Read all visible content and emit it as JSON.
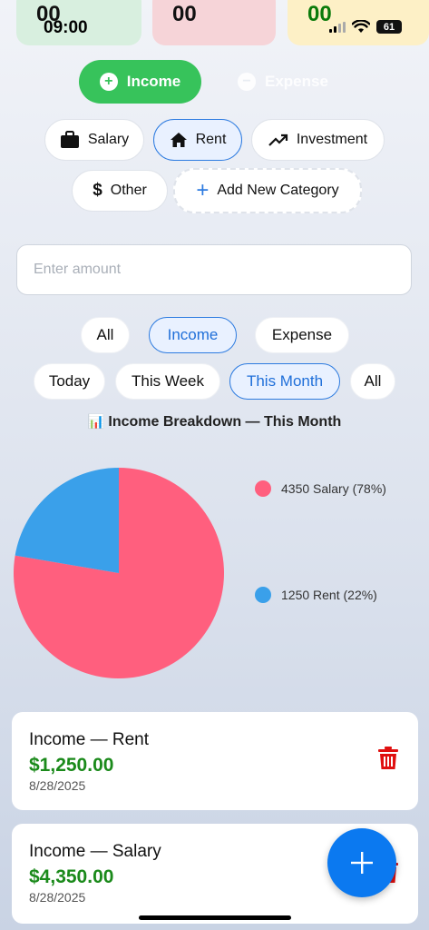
{
  "status_bar": {
    "time": "09:00",
    "battery": "61"
  },
  "summary": {
    "income_value": "00",
    "expense_value": "00",
    "balance_value": "00"
  },
  "type_toggle": {
    "income_label": "Income",
    "expense_label": "Expense",
    "selected": "Income"
  },
  "categories": [
    {
      "label": "Salary",
      "icon": "briefcase-icon"
    },
    {
      "label": "Rent",
      "icon": "home-icon",
      "selected": true
    },
    {
      "label": "Investment",
      "icon": "trending-up-icon"
    },
    {
      "label": "Other",
      "icon": "dollar-icon"
    },
    {
      "label": "Add New Category",
      "icon": "plus-icon"
    }
  ],
  "amount_input": {
    "placeholder": "Enter amount",
    "value": ""
  },
  "type_filter": {
    "options": [
      "All",
      "Income",
      "Expense"
    ],
    "selected": "Income"
  },
  "period_filter": {
    "options": [
      "Today",
      "This Week",
      "This Month",
      "All"
    ],
    "selected": "This Month"
  },
  "breakdown": {
    "title": "Income Breakdown — This Month"
  },
  "chart_data": {
    "type": "pie",
    "title": "Income Breakdown — This Month",
    "slices": [
      {
        "label": "Salary",
        "value": 4350,
        "percent": 78,
        "color": "#ff5f7e",
        "legend": "4350 Salary (78%)"
      },
      {
        "label": "Rent",
        "value": 1250,
        "percent": 22,
        "color": "#3aa0ea",
        "legend": "1250 Rent (22%)"
      }
    ],
    "legend_placement": "right"
  },
  "transactions": [
    {
      "title": "Income — Rent",
      "amount": "$1,250.00",
      "date": "8/28/2025"
    },
    {
      "title": "Income — Salary",
      "amount": "$4,350.00",
      "date": "8/28/2025"
    }
  ],
  "colors": {
    "accent": "#0b79f0",
    "income": "#37c35b",
    "amount_green": "#1b8a1b",
    "delete_red": "#e01010"
  }
}
